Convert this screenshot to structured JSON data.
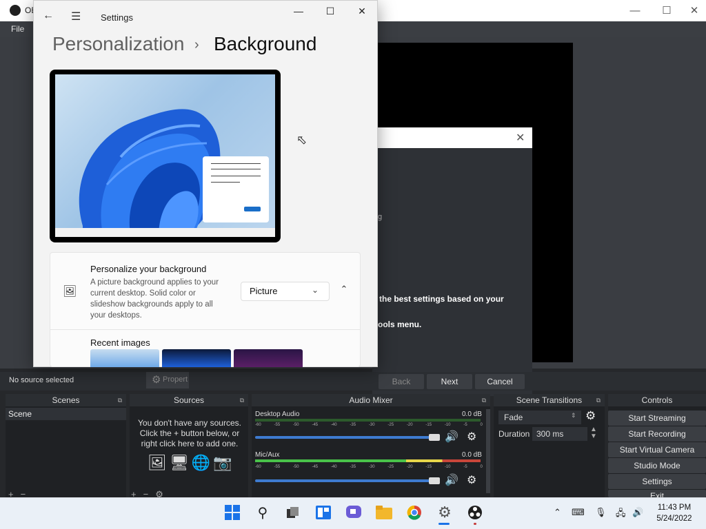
{
  "obs": {
    "title": "OB",
    "menu_file": "File",
    "wizard_text1": "the best settings based on your",
    "wizard_text2": "ools menu.",
    "wizard_frag": "g",
    "no_source": "No source selected",
    "properties_label": "Propert",
    "back_label": "Back",
    "next_label": "Next",
    "cancel_label": "Cancel",
    "docks": {
      "scenes": "Scenes",
      "sources": "Sources",
      "mixer": "Audio Mixer",
      "transitions": "Scene Transitions",
      "controls": "Controls"
    },
    "scene_item": "Scene",
    "sources_empty": "You don't have any sources. Click the + button below, or right click here to add one.",
    "mixer": [
      {
        "name": "Desktop Audio",
        "db": "0.0 dB"
      },
      {
        "name": "Mic/Aux",
        "db": "0.0 dB"
      }
    ],
    "meter_scale": [
      "-60",
      "-55",
      "-50",
      "-45",
      "-40",
      "-35",
      "-30",
      "-25",
      "-20",
      "-15",
      "-10",
      "-5",
      "0"
    ],
    "transition": "Fade",
    "duration_label": "Duration",
    "duration_value": "300 ms",
    "controls": [
      "Start Streaming",
      "Start Recording",
      "Start Virtual Camera",
      "Studio Mode",
      "Settings",
      "Exit"
    ]
  },
  "settings": {
    "title": "Settings",
    "breadcrumb_parent": "Personalization",
    "breadcrumb_current": "Background",
    "card_title": "Personalize your background",
    "card_desc": "A picture background applies to your current desktop. Solid color or slideshow backgrounds apply to all your desktops.",
    "background_type": "Picture",
    "recent_images_label": "Recent images"
  },
  "taskbar": {
    "time": "11:43 PM",
    "date": "5/24/2022"
  }
}
